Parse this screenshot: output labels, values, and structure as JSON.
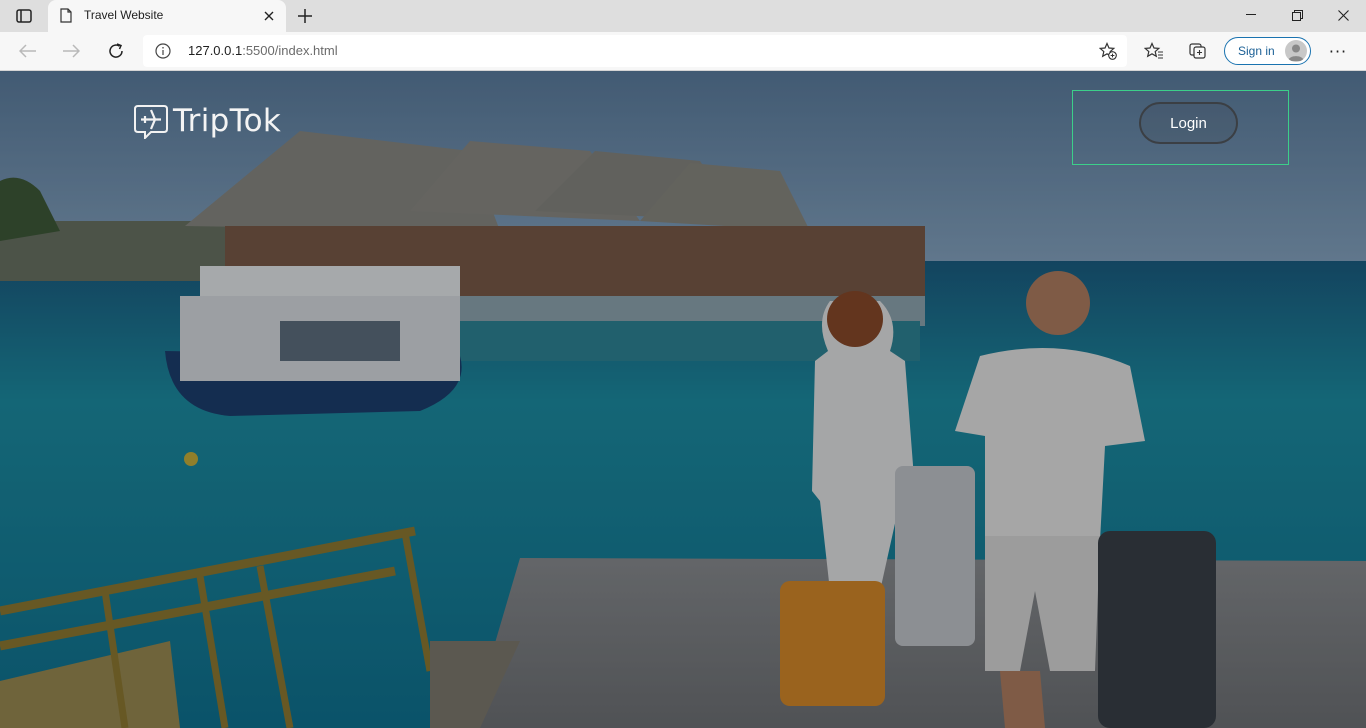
{
  "browser": {
    "tab_title": "Travel Website",
    "url_host": "127.0.0.1",
    "url_path": ":5500/index.html",
    "signin_label": "Sign in"
  },
  "page": {
    "logo_text": "TripTok",
    "login_label": "Login"
  },
  "colors": {
    "login_outline": "#3ccf8a",
    "signin_border": "#1a73b0"
  }
}
